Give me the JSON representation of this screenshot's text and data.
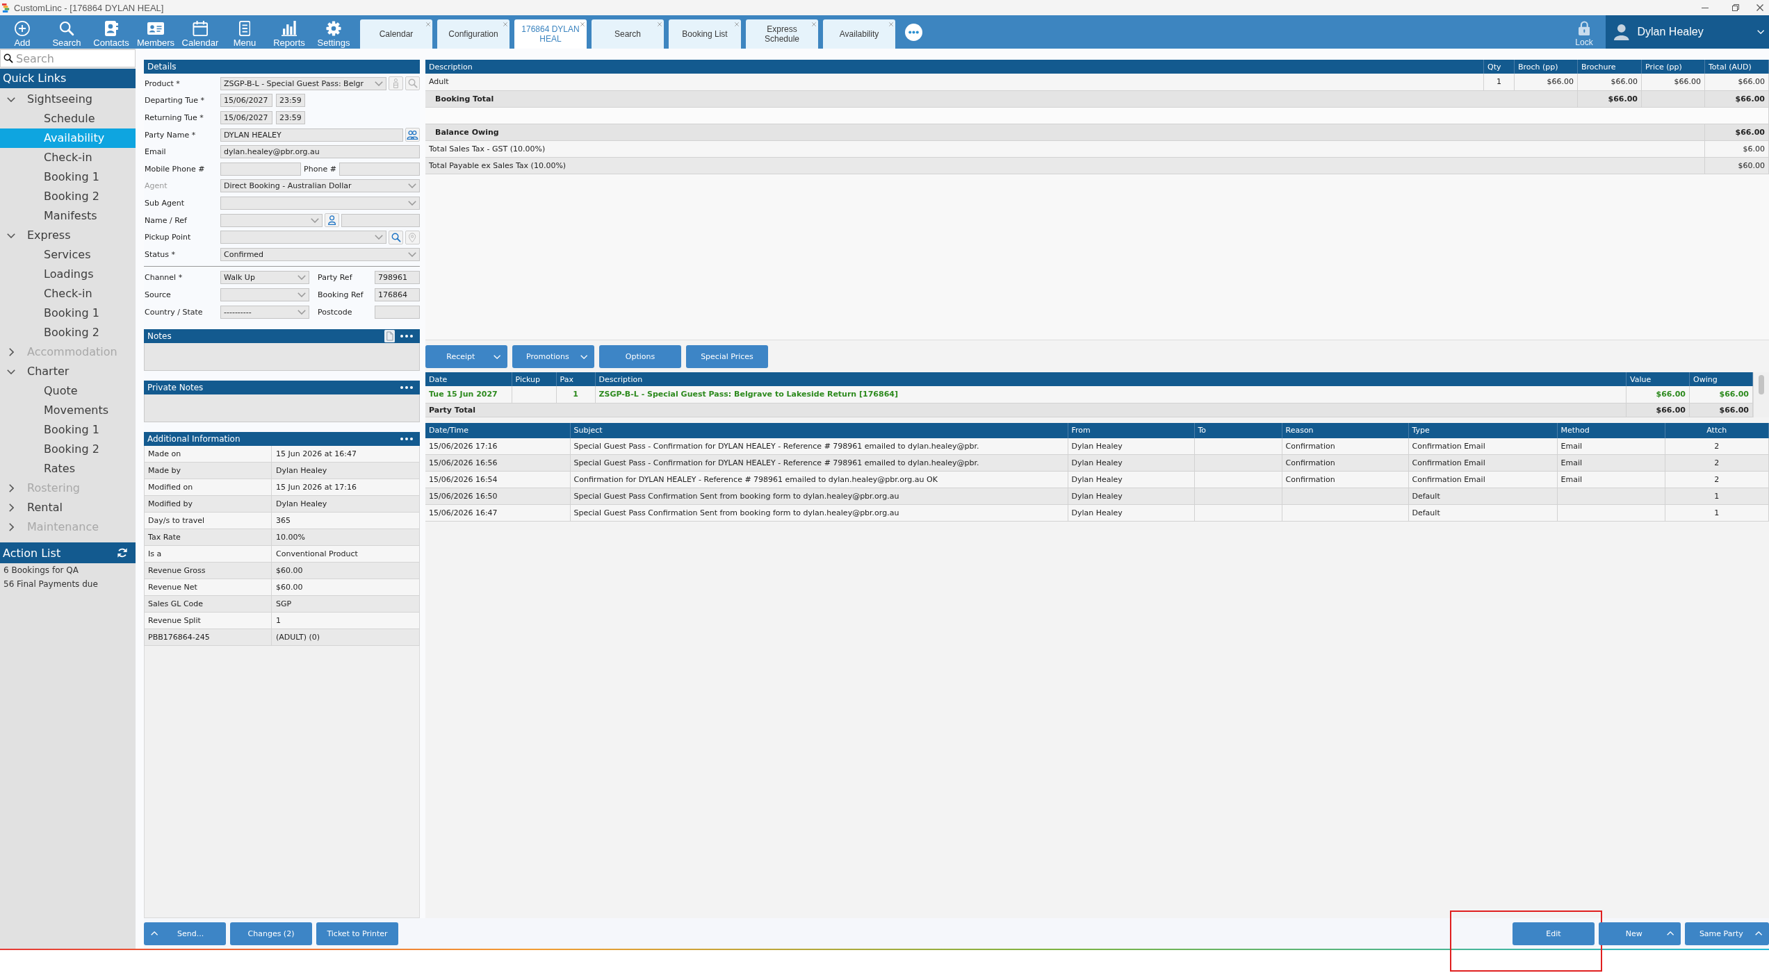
{
  "window": {
    "title": "CustomLinc - [176864 DYLAN HEAL]"
  },
  "toolbar": {
    "tools": [
      {
        "kind": "add",
        "label": "Add"
      },
      {
        "kind": "search",
        "label": "Search"
      },
      {
        "kind": "contacts",
        "label": "Contacts"
      },
      {
        "kind": "members",
        "label": "Members"
      },
      {
        "kind": "calendar",
        "label": "Calendar"
      },
      {
        "kind": "menu",
        "label": "Menu"
      },
      {
        "kind": "reports",
        "label": "Reports"
      },
      {
        "kind": "settings",
        "label": "Settings"
      }
    ],
    "tabs": [
      {
        "label": "Calendar",
        "selected": false
      },
      {
        "label": "Configuration",
        "selected": false
      },
      {
        "label": "176864 DYLAN HEAL",
        "selected": true
      },
      {
        "label": "Search",
        "selected": false
      },
      {
        "label": "Booking List",
        "selected": false
      },
      {
        "label": "Express Schedule",
        "selected": false
      },
      {
        "label": "Availability",
        "selected": false
      }
    ],
    "lock": {
      "label": "Lock"
    },
    "user": {
      "name": "Dylan Healey"
    }
  },
  "sidebar": {
    "search": {
      "placeholder": "Search"
    },
    "quick_links": {
      "title": "Quick Links",
      "items": [
        {
          "label": "Sightseeing",
          "expanded": true,
          "disabled": false,
          "selected": false,
          "children": [
            {
              "label": "Schedule",
              "selected": false
            },
            {
              "label": "Availability",
              "selected": true
            },
            {
              "label": "Check-in",
              "selected": false
            },
            {
              "label": "Booking 1",
              "selected": false
            },
            {
              "label": "Booking 2",
              "selected": false
            },
            {
              "label": "Manifests",
              "selected": false
            }
          ]
        },
        {
          "label": "Express",
          "expanded": true,
          "disabled": false,
          "selected": false,
          "children": [
            {
              "label": "Services",
              "selected": false
            },
            {
              "label": "Loadings",
              "selected": false
            },
            {
              "label": "Check-in",
              "selected": false
            },
            {
              "label": "Booking 1",
              "selected": false
            },
            {
              "label": "Booking 2",
              "selected": false
            }
          ]
        },
        {
          "label": "Accommodation",
          "expanded": false,
          "disabled": true,
          "selected": false
        },
        {
          "label": "Charter",
          "expanded": true,
          "disabled": false,
          "selected": false,
          "children": [
            {
              "label": "Quote",
              "selected": false
            },
            {
              "label": "Movements",
              "selected": false
            },
            {
              "label": "Booking 1",
              "selected": false
            },
            {
              "label": "Booking 2",
              "selected": false
            },
            {
              "label": "Rates",
              "selected": false
            }
          ]
        },
        {
          "label": "Rostering",
          "expanded": false,
          "disabled": true,
          "selected": false
        },
        {
          "label": "Rental",
          "expanded": false,
          "disabled": false,
          "selected": false
        },
        {
          "label": "Maintenance",
          "expanded": false,
          "disabled": true,
          "selected": false
        }
      ]
    },
    "action_list": {
      "title": "Action List",
      "items": [
        "6 Bookings for QA",
        "56 Final Payments due"
      ]
    }
  },
  "details": {
    "title": "Details",
    "fields": [
      {
        "label": "Product *",
        "disabled": false,
        "controls": [
          {
            "kind": "select",
            "value": "ZSGP-B-L - Special Guest Pass: Belgr"
          },
          {
            "kind": "tag",
            "disabled": true
          },
          {
            "kind": "search",
            "disabled": true
          }
        ]
      },
      {
        "label": "Departing Tue *",
        "disabled": false,
        "controls": [
          {
            "kind": "date",
            "value": "15/06/2027"
          },
          {
            "kind": "time",
            "value": "23:59"
          }
        ]
      },
      {
        "label": "Returning Tue *",
        "disabled": false,
        "controls": [
          {
            "kind": "date",
            "value": "15/06/2027"
          },
          {
            "kind": "time",
            "value": "23:59"
          }
        ]
      },
      {
        "label": "Party Name *",
        "disabled": false,
        "controls": [
          {
            "kind": "input",
            "value": "DYLAN HEALEY"
          },
          {
            "kind": "people",
            "disabled": false
          }
        ]
      },
      {
        "label": "Email",
        "disabled": false,
        "controls": [
          {
            "kind": "input",
            "value": "dylan.healey@pbr.org.au"
          }
        ]
      },
      {
        "label": "Mobile Phone #",
        "disabled": false,
        "controls": [
          {
            "kind": "input"
          },
          {
            "kind": "caption",
            "text": "Phone #"
          },
          {
            "kind": "input"
          }
        ]
      },
      {
        "label": "Agent",
        "disabled": true,
        "controls": [
          {
            "kind": "select",
            "value": "Direct Booking - Australian Dollar"
          }
        ]
      },
      {
        "label": "Sub Agent",
        "disabled": false,
        "controls": [
          {
            "kind": "select"
          }
        ]
      },
      {
        "label": "Name / Ref",
        "disabled": false,
        "controls": [
          {
            "kind": "select"
          },
          {
            "kind": "person",
            "disabled": false
          },
          {
            "kind": "input"
          }
        ]
      },
      {
        "label": "Pickup Point",
        "disabled": false,
        "controls": [
          {
            "kind": "select"
          },
          {
            "kind": "search",
            "disabled": false
          },
          {
            "kind": "pin",
            "disabled": true
          }
        ]
      },
      {
        "label": "Status *",
        "disabled": false,
        "controls": [
          {
            "kind": "select",
            "value": "Confirmed"
          }
        ]
      }
    ],
    "references": [
      {
        "label": "Channel *",
        "kind": "select",
        "value": "Walk Up"
      },
      {
        "label": "Party Ref",
        "kind": "input",
        "value": "798961"
      },
      {
        "label": "Source",
        "kind": "select"
      },
      {
        "label": "Booking Ref",
        "kind": "input",
        "value": "176864"
      },
      {
        "label": "Country / State",
        "kind": "select",
        "value": "----------"
      },
      {
        "label": "Postcode",
        "kind": "input"
      }
    ]
  },
  "notes": {
    "title": "Notes"
  },
  "private_notes": {
    "title": "Private Notes"
  },
  "additional_info": {
    "title": "Additional Information",
    "rows": [
      {
        "label": "Made on",
        "value": "15 Jun 2026 at 16:47"
      },
      {
        "label": "Made by",
        "value": "Dylan Healey"
      },
      {
        "label": "Modified on",
        "value": "15 Jun 2026 at 17:16"
      },
      {
        "label": "Modified by",
        "value": "Dylan Healey"
      },
      {
        "label": "Day/s to travel",
        "value": "365"
      },
      {
        "label": "Tax Rate",
        "value": "10.00%"
      },
      {
        "label": "Is a",
        "value": "Conventional Product"
      },
      {
        "label": "Revenue Gross",
        "value": "$60.00"
      },
      {
        "label": "Revenue Net",
        "value": "$60.00"
      },
      {
        "label": "Sales GL Code",
        "value": "SGP"
      },
      {
        "label": "Revenue Split",
        "value": "1"
      },
      {
        "label": "PBB176864-245",
        "value": "(ADULT) (0)"
      }
    ]
  },
  "booking": {
    "columns": [
      "Description",
      "Qty",
      "Broch (pp)",
      "Brochure",
      "Price (pp)",
      "Total (AUD)"
    ],
    "rows": [
      {
        "kind": "item",
        "description": "Adult",
        "qty": "1",
        "broch_pp": "$66.00",
        "brochure": "$66.00",
        "price_pp": "$66.00",
        "total": "$66.00"
      },
      {
        "kind": "total",
        "label": "Booking Total",
        "brochure": "$66.00",
        "total": "$66.00"
      },
      {
        "kind": "spacer"
      },
      {
        "kind": "balance",
        "label": "Balance Owing",
        "total": "$66.00"
      },
      {
        "kind": "summary",
        "label": "Total Sales Tax - GST (10.00%)",
        "total": "$6.00"
      },
      {
        "kind": "summary",
        "label": "Total Payable ex Sales Tax (10.00%)",
        "total": "$60.00"
      }
    ]
  },
  "actions": [
    {
      "label": "Receipt",
      "dropdown": true
    },
    {
      "label": "Promotions",
      "dropdown": true
    },
    {
      "label": "Options",
      "dropdown": false
    },
    {
      "label": "Special Prices",
      "dropdown": false
    }
  ],
  "party_table": {
    "columns": [
      "Date",
      "Pickup",
      "Pax",
      "Description",
      "Value",
      "Owing"
    ],
    "rows": [
      {
        "kind": "leg",
        "date": "Tue 15 Jun 2027",
        "pax": "1",
        "description": "ZSGP-B-L - Special Guest Pass: Belgrave to Lakeside Return [176864]",
        "value": "$66.00",
        "owing": "$66.00"
      },
      {
        "kind": "total",
        "label": "Party Total",
        "value": "$66.00",
        "owing": "$66.00"
      }
    ]
  },
  "communications": {
    "columns": [
      "Date/Time",
      "Subject",
      "From",
      "To",
      "Reason",
      "Type",
      "Method",
      "Attch"
    ],
    "rows": [
      {
        "date_time": "15/06/2026 17:16",
        "subject": "Special Guest Pass - Confirmation for DYLAN HEALEY - Reference # 798961 emailed to dylan.healey@pbr.",
        "from": "Dylan Healey",
        "reason": "Confirmation",
        "type": "Confirmation Email",
        "method": "Email",
        "attachments": "2"
      },
      {
        "date_time": "15/06/2026 16:56",
        "subject": "Special Guest Pass - Confirmation for DYLAN HEALEY - Reference # 798961 emailed to dylan.healey@pbr.",
        "from": "Dylan Healey",
        "reason": "Confirmation",
        "type": "Confirmation Email",
        "method": "Email",
        "attachments": "2"
      },
      {
        "date_time": "15/06/2026 16:54",
        "subject": "Confirmation for DYLAN HEALEY - Reference # 798961 emailed to dylan.healey@pbr.org.au OK",
        "from": "Dylan Healey",
        "reason": "Confirmation",
        "type": "Confirmation Email",
        "method": "Email",
        "attachments": "2"
      },
      {
        "date_time": "15/06/2026 16:50",
        "subject": "Special Guest Pass Confirmation Sent from booking form to dylan.healey@pbr.org.au",
        "from": "Dylan Healey",
        "type": "Default",
        "attachments": "1"
      },
      {
        "date_time": "15/06/2026 16:47",
        "subject": "Special Guest Pass Confirmation Sent from booking form to dylan.healey@pbr.org.au",
        "from": "Dylan Healey",
        "type": "Default",
        "attachments": "1"
      }
    ]
  },
  "bottom_bar": {
    "left_buttons": [
      {
        "label": "Send...",
        "menu": true
      },
      {
        "label": "Changes (2)",
        "menu": false
      },
      {
        "label": "Ticket to Printer",
        "menu": false
      }
    ],
    "right_buttons": [
      {
        "label": "Edit",
        "menu": false,
        "highlighted": true
      },
      {
        "label": "New",
        "menu": true,
        "highlighted": false
      },
      {
        "label": "Same Party",
        "menu": true,
        "highlighted": false
      }
    ]
  }
}
